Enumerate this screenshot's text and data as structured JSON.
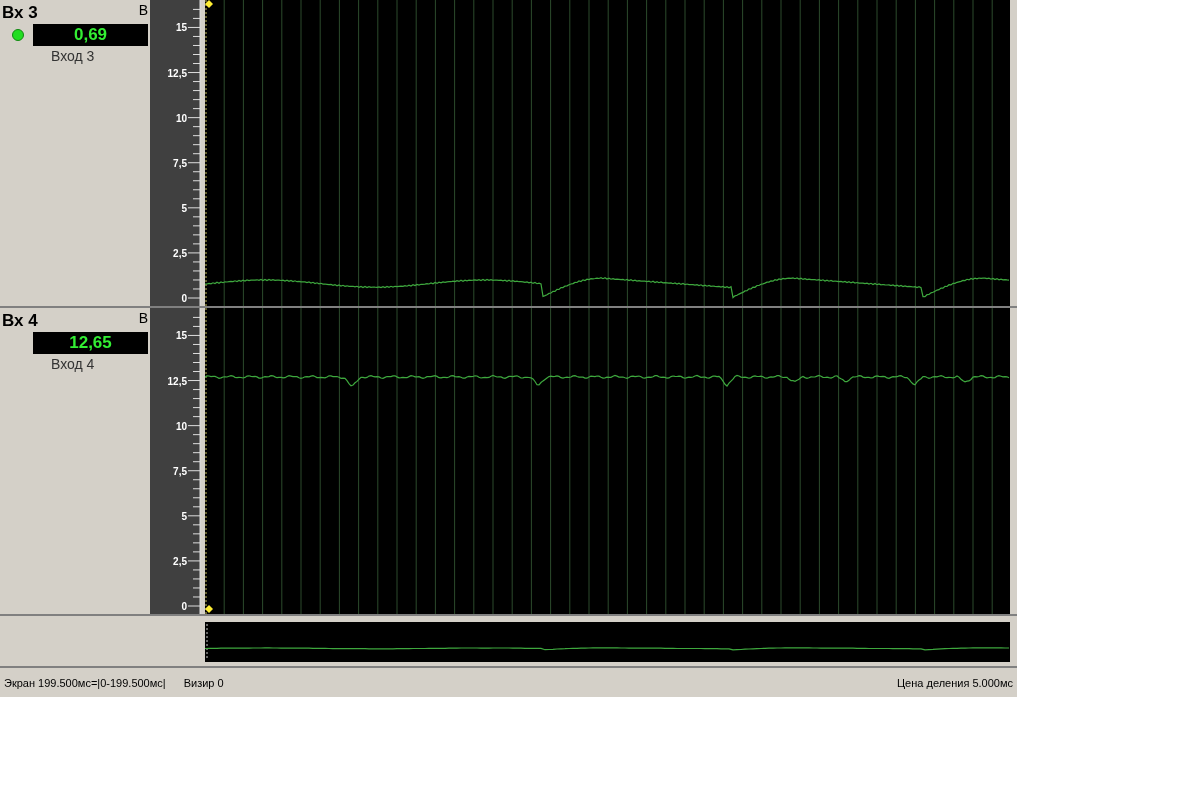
{
  "channels": [
    {
      "name": "Вх 3",
      "unit": "В",
      "indicator": true,
      "value": "0,69",
      "label": "Вход 3",
      "y_axis_labels": [
        "15",
        "12,5",
        "10",
        "7,5",
        "5",
        "2,5",
        "0"
      ]
    },
    {
      "name": "Вх 4",
      "unit": "В",
      "indicator": false,
      "value": "12,65",
      "label": "Вход 4",
      "y_axis_labels": [
        "15",
        "12,5",
        "10",
        "7,5",
        "5",
        "2,5",
        "0"
      ]
    }
  ],
  "status_bar": {
    "screen": "Экран 199.500мс=|0-199.500мс|",
    "cursor": "Визир 0",
    "division": "Цена деления 5.000мс"
  }
}
